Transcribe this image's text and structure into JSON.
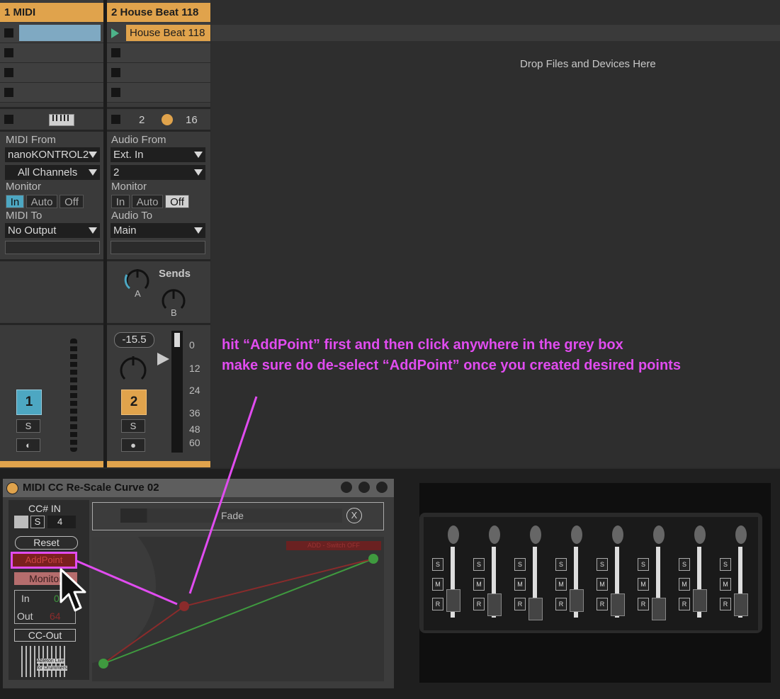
{
  "tracks": [
    {
      "name": "1 MIDI",
      "io": {
        "from_label": "MIDI From",
        "from_value": "nanoKONTROL2",
        "channel_value": "All Channels",
        "monitor_label": "Monitor",
        "monitor_options": [
          "In",
          "Auto",
          "Off"
        ],
        "monitor_selected": "In",
        "to_label": "MIDI To",
        "to_value": "No Output"
      },
      "number": "1",
      "solo": "S"
    },
    {
      "name": "2 House Beat 118",
      "playing_clip": "House Beat 118",
      "mixer_numbers": [
        "2",
        "16"
      ],
      "io": {
        "from_label": "Audio From",
        "from_value": "Ext. In",
        "channel_value": "2",
        "monitor_label": "Monitor",
        "monitor_options": [
          "In",
          "Auto",
          "Off"
        ],
        "monitor_selected": "Off",
        "to_label": "Audio To",
        "to_value": "Main"
      },
      "sends_label": "Sends",
      "send_a": "A",
      "send_b": "B",
      "volume": "-15.5",
      "meter_ticks": [
        "0",
        "12",
        "24",
        "36",
        "48",
        "60"
      ],
      "number": "2",
      "solo": "S"
    }
  ],
  "drop_zone": "Drop Files and Devices Here",
  "annotation": {
    "line1": "hit “AddPoint” first and then click anywhere in the grey box",
    "line2": "make sure do de-select “AddPoint” once you created desired points",
    "color": "#e14cf0"
  },
  "device": {
    "title": "MIDI CC Re-Scale Curve 02",
    "cc_in_label": "CC# IN",
    "s_label": "S",
    "cc_value": "4",
    "reset": "Reset",
    "add_point": "AddPoint",
    "monitor": "Monitor",
    "in_label": "In",
    "in_value": "0",
    "out_label": "Out",
    "out_value": "64",
    "cc_out": "CC-Out",
    "logo_line1": "Ableton Live",
    "logo_line2": "for Drummers",
    "fade_label": "Fade",
    "clear_symbol": "X",
    "curve_tag": "ADD - Switch OFF",
    "curve_colors": {
      "output": "#3f9a3f",
      "input": "#8a2b2b"
    }
  },
  "controller_strips": 8,
  "controller_buttons": [
    "S",
    "M",
    "R"
  ]
}
